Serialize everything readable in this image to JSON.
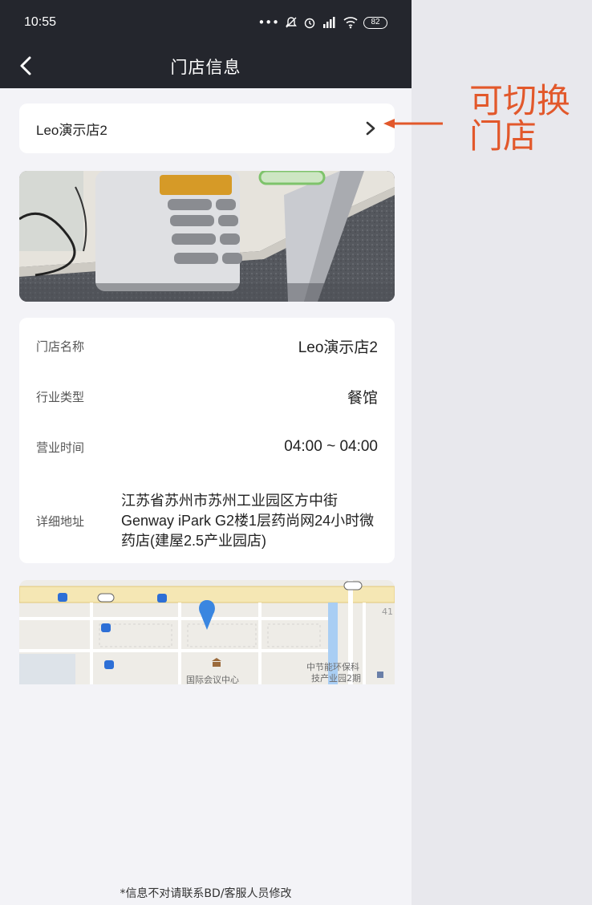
{
  "status_bar": {
    "time": "10:55",
    "icons": [
      "more-dots-icon",
      "silent-icon",
      "alarm-icon",
      "hd-signal-icon",
      "wifi-icon"
    ],
    "battery": "82"
  },
  "nav": {
    "title": "门店信息",
    "back_icon": "back-chevron-icon"
  },
  "store_selector": {
    "name": "Leo演示店2",
    "chevron_icon": "chevron-right-icon"
  },
  "store_info": [
    {
      "label": "门店名称",
      "value": "Leo演示店2"
    },
    {
      "label": "行业类型",
      "value": "餐馆"
    },
    {
      "label": "营业时间",
      "value": "04:00 ~ 04:00"
    },
    {
      "label": "详细地址",
      "value": "江苏省苏州市苏州工业园区方中街Genway iPark G2楼1层药尚网24小时微药店(建屋2.5产业园店)"
    }
  ],
  "map": {
    "labels": [
      "国际会议中心",
      "中节能环保科技产业园2期",
      "41"
    ],
    "pin_color": "#3a86e0"
  },
  "footer": {
    "note": "*信息不对请联系BD/客服人员修改"
  },
  "annotation": {
    "text": "可切换门店",
    "color": "#e2582b"
  },
  "colors": {
    "header_bg": "#24262d",
    "page_bg": "#f3f3f7",
    "card_bg": "#ffffff"
  }
}
